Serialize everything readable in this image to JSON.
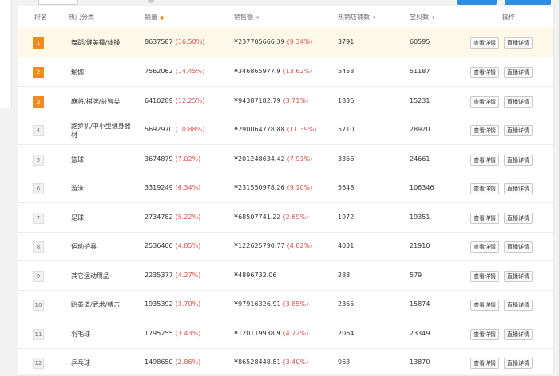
{
  "columns": {
    "rank": "排名",
    "category": "热门分类",
    "sales": "销量",
    "revenue": "销售额",
    "stores": "热销店铺数",
    "items": "宝贝数",
    "actions": "操作"
  },
  "buttons": {
    "detail": "查看详情",
    "live": "直播详情"
  },
  "colors": {
    "accent": "#f08a24",
    "percent": "#d9534f",
    "highlight": "#fdf8e8",
    "primary_btn": "#2f8ddf"
  },
  "rows": [
    {
      "rank": "1",
      "category": "舞蹈/健美操/体操",
      "sales": "8637587",
      "sales_pct": "(16.50%)",
      "revenue": "¥237705666.39",
      "revenue_pct": "(9.34%)",
      "stores": "3791",
      "items": "60595"
    },
    {
      "rank": "2",
      "category": "瑜伽",
      "sales": "7562062",
      "sales_pct": "(14.45%)",
      "revenue": "¥346865977.9",
      "revenue_pct": "(13.62%)",
      "stores": "5458",
      "items": "51187"
    },
    {
      "rank": "3",
      "category": "麻将/棋牌/益智类",
      "sales": "6410289",
      "sales_pct": "(12.25%)",
      "revenue": "¥94387182.79",
      "revenue_pct": "(3.71%)",
      "stores": "1836",
      "items": "15231"
    },
    {
      "rank": "4",
      "category": "跑步机/中小型健身器材",
      "sales": "5692970",
      "sales_pct": "(10.88%)",
      "revenue": "¥290064778.88",
      "revenue_pct": "(11.39%)",
      "stores": "5710",
      "items": "28920"
    },
    {
      "rank": "5",
      "category": "篮球",
      "sales": "3674879",
      "sales_pct": "(7.02%)",
      "revenue": "¥201248634.42",
      "revenue_pct": "(7.91%)",
      "stores": "3366",
      "items": "24661"
    },
    {
      "rank": "6",
      "category": "游泳",
      "sales": "3319249",
      "sales_pct": "(6.34%)",
      "revenue": "¥231550978.26",
      "revenue_pct": "(9.10%)",
      "stores": "5648",
      "items": "106346"
    },
    {
      "rank": "7",
      "category": "足球",
      "sales": "2734782",
      "sales_pct": "(5.22%)",
      "revenue": "¥68507741.22",
      "revenue_pct": "(2.69%)",
      "stores": "1972",
      "items": "19351"
    },
    {
      "rank": "8",
      "category": "运动护具",
      "sales": "2536400",
      "sales_pct": "(4.85%)",
      "revenue": "¥122625790.77",
      "revenue_pct": "(4.82%)",
      "stores": "4031",
      "items": "21910"
    },
    {
      "rank": "9",
      "category": "其它运动用品",
      "sales": "2235377",
      "sales_pct": "(4.27%)",
      "revenue": "¥4896732.06",
      "revenue_pct": "",
      "stores": "288",
      "items": "579"
    },
    {
      "rank": "10",
      "category": "跆拳道/武术/搏击",
      "sales": "1935392",
      "sales_pct": "(3.70%)",
      "revenue": "¥97916326.91",
      "revenue_pct": "(3.85%)",
      "stores": "2365",
      "items": "15874"
    },
    {
      "rank": "11",
      "category": "羽毛球",
      "sales": "1795255",
      "sales_pct": "(3.43%)",
      "revenue": "¥120119938.9",
      "revenue_pct": "(4.72%)",
      "stores": "2064",
      "items": "23349"
    },
    {
      "rank": "12",
      "category": "乒乓球",
      "sales": "1498650",
      "sales_pct": "(2.86%)",
      "revenue": "¥86528448.81",
      "revenue_pct": "(3.40%)",
      "stores": "963",
      "items": "13870"
    }
  ]
}
